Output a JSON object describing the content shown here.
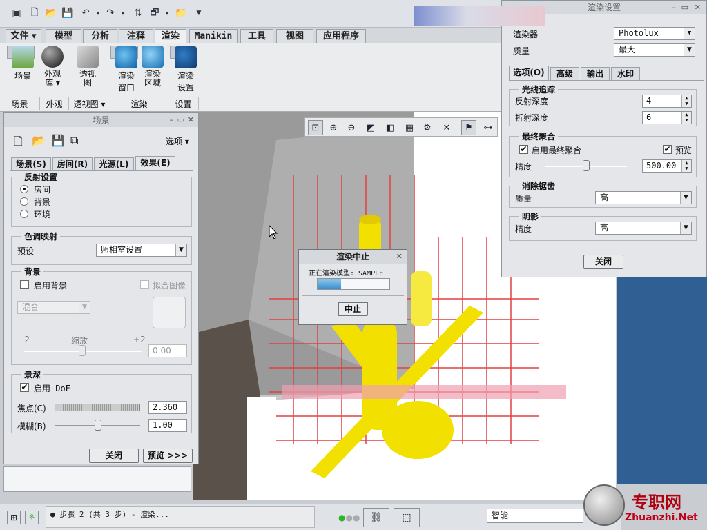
{
  "ribbon": {
    "tabs": [
      "文件 ▾",
      "模型",
      "分析",
      "注释",
      "渲染",
      "Manikin",
      "工具",
      "视图",
      "应用程序"
    ],
    "buttons": [
      {
        "label": "场景"
      },
      {
        "label": "外观\n库 ▾"
      },
      {
        "label": "透视\n图"
      },
      {
        "label": "渲染\n窗口"
      },
      {
        "label": "渲染\n区域"
      },
      {
        "label": "渲染\n设置"
      }
    ],
    "groups": [
      "场景",
      "外观",
      "透视图 ▾",
      "渲染",
      "设置"
    ]
  },
  "scene_panel": {
    "title": "场景",
    "options_label": "选项 ▾",
    "tabs": [
      "场景(S)",
      "房间(R)",
      "光源(L)",
      "效果(E)"
    ],
    "reflection": {
      "legend": "反射设置",
      "options": [
        "房间",
        "背景",
        "环境"
      ],
      "selected": "房间"
    },
    "tone": {
      "legend": "色调映射",
      "preset_label": "预设",
      "preset_value": "照相室设置"
    },
    "background": {
      "legend": "背景",
      "enable_label": "启用背景",
      "fit_label": "拟合图像",
      "blend_value": "混合",
      "scale_min": "-2",
      "scale_label": "缩放",
      "scale_max": "+2",
      "scale_value": "0.00"
    },
    "dof": {
      "legend": "景深",
      "enable_label": "启用 DoF",
      "focus_label": "焦点(C)",
      "focus_value": "2.360",
      "blur_label": "模糊(B)",
      "blur_value": "1.00"
    },
    "close_label": "关闭",
    "preview_label": "预览 >>>"
  },
  "render_settings": {
    "title": "渲染设置",
    "renderer_label": "渲染器",
    "renderer_value": "Photolux",
    "quality_label": "质量",
    "quality_value": "最大",
    "tabs": [
      "选项(O)",
      "高级",
      "输出",
      "水印"
    ],
    "raytrace": {
      "legend": "光线追踪",
      "reflect_label": "反射深度",
      "reflect_value": "4",
      "refract_label": "折射深度",
      "refract_value": "6"
    },
    "final_gather": {
      "legend": "最终聚合",
      "enable_label": "启用最终聚合",
      "preview_label": "预览",
      "precision_label": "精度",
      "precision_value": "500.00"
    },
    "antialias": {
      "legend": "消除锯齿",
      "quality_label": "质量",
      "quality_value": "高"
    },
    "shadow": {
      "legend": "阴影",
      "precision_label": "精度",
      "precision_value": "高"
    },
    "close_label": "关闭"
  },
  "render_dialog": {
    "title": "渲染中止",
    "message": "正在渲染模型:  SAMPLE",
    "progress": 0.33,
    "stop_label": "中止"
  },
  "status_bar": {
    "message": "● 步骤 2 (共 3 步) - 渲染...",
    "filter_value": "智能"
  },
  "watermark": {
    "name": "专职网",
    "url": "Zhuanzhi.Net"
  }
}
